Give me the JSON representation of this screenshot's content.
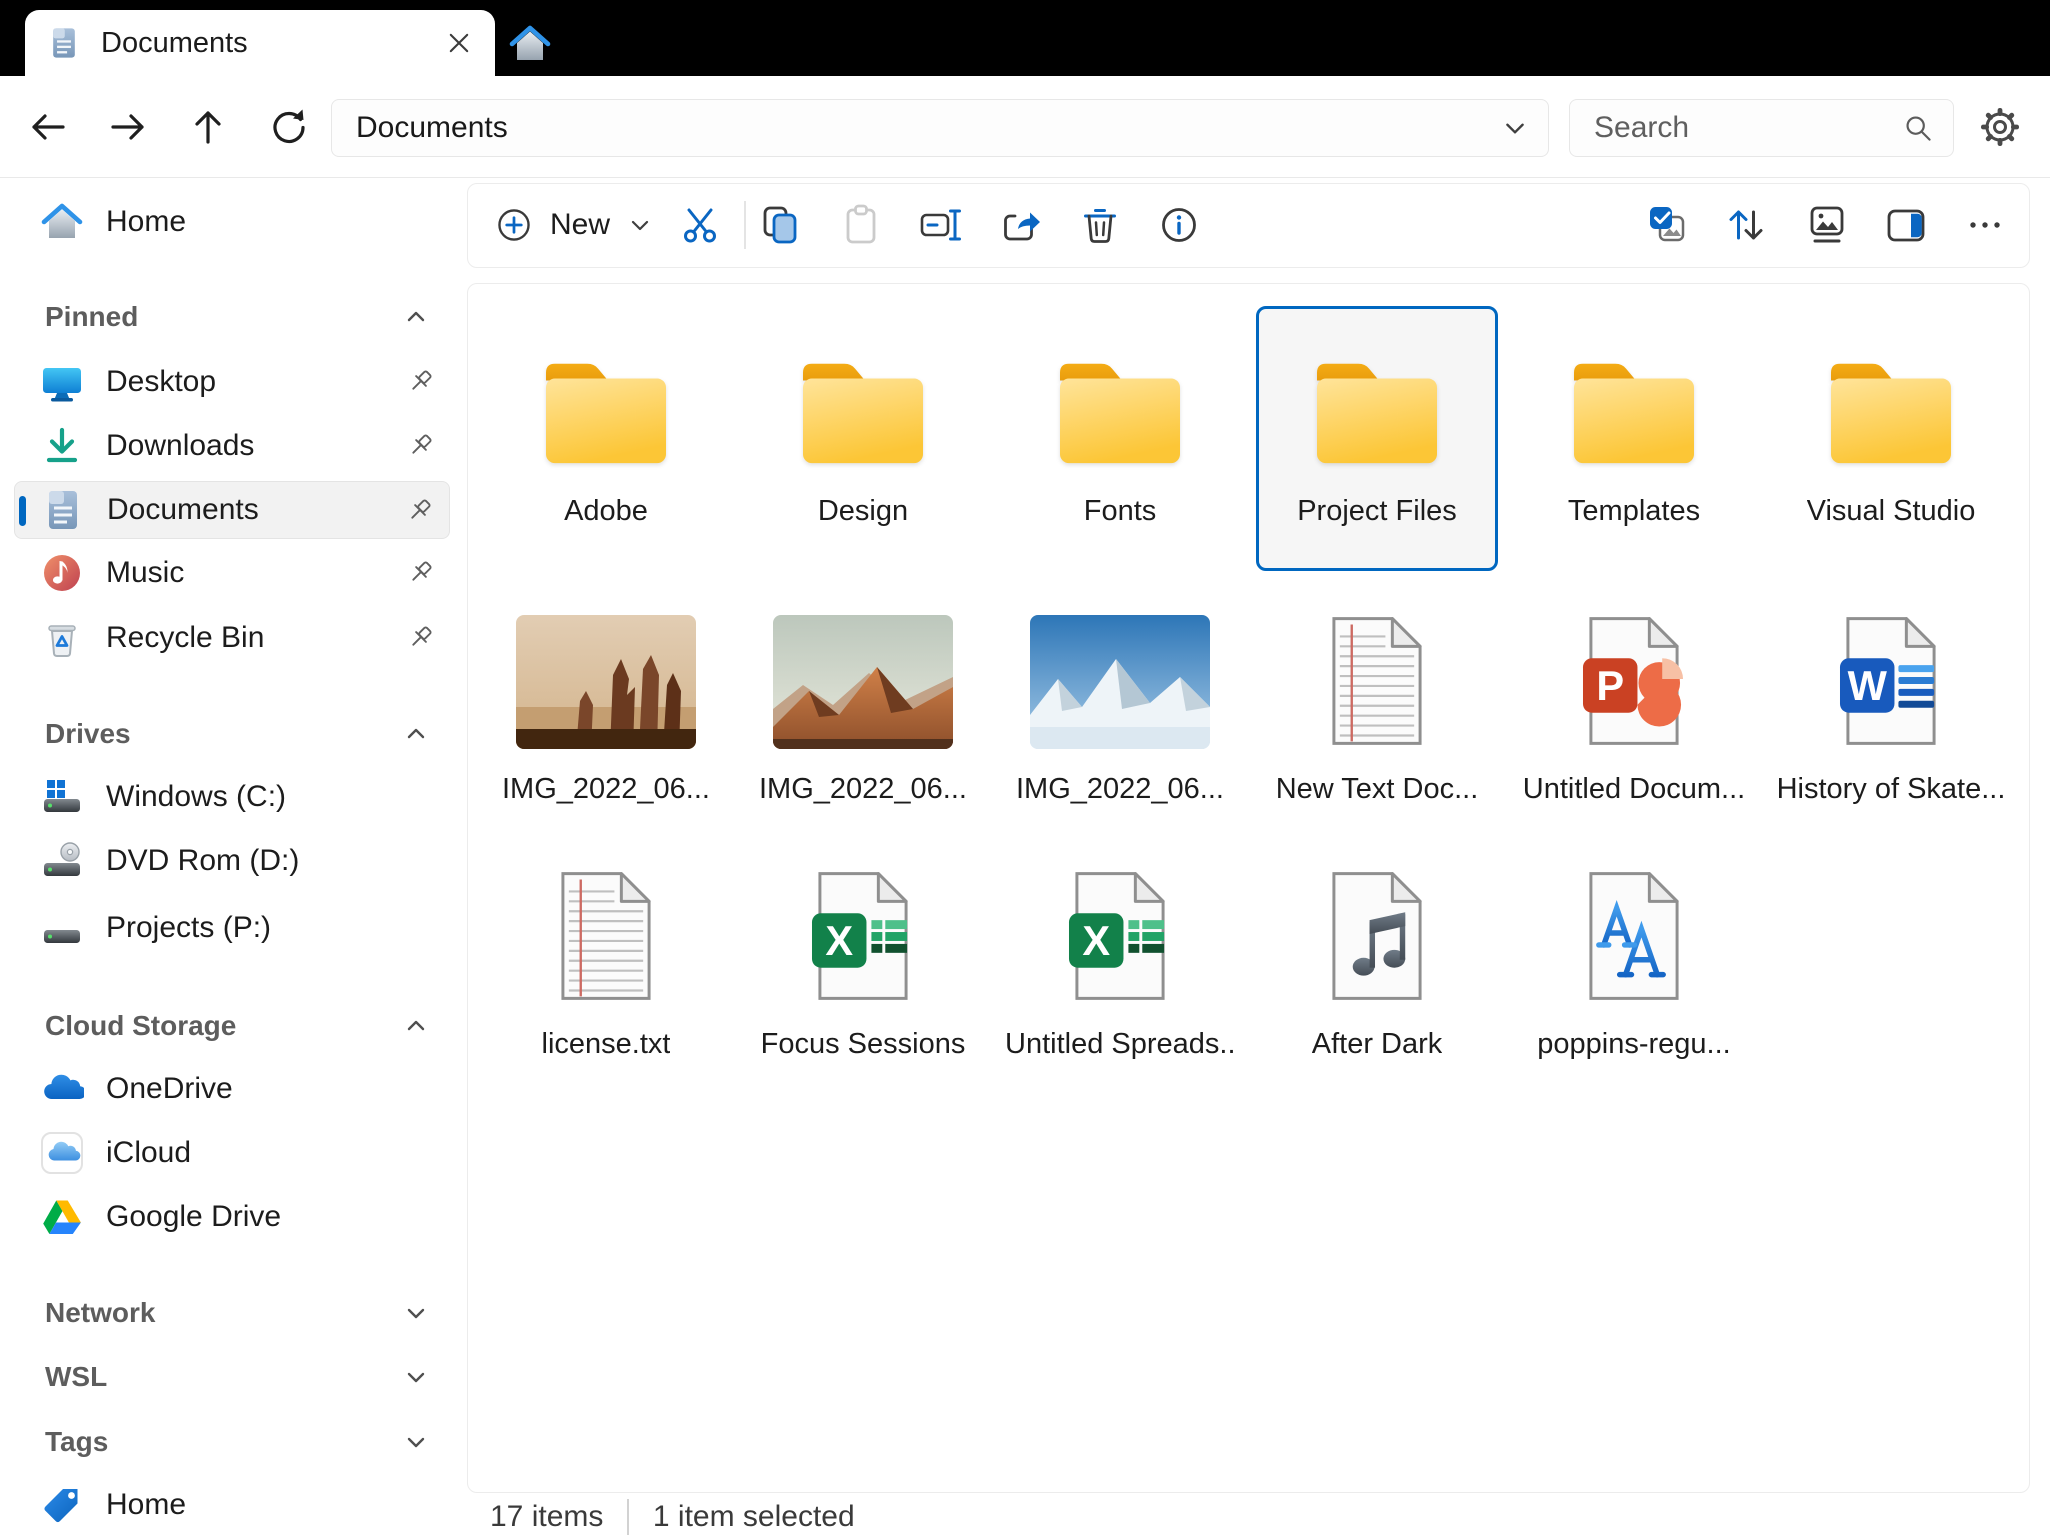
{
  "titlebar": {
    "tab_title": "Documents",
    "tab_icon": "document-icon",
    "home_tab_icon": "home-icon",
    "close_icon": "close-icon"
  },
  "navbar": {
    "nav_icons": [
      "arrow-left",
      "arrow-right",
      "arrow-up",
      "refresh"
    ],
    "address": "Documents",
    "search_placeholder": "Search",
    "settings_icon": "gear-icon"
  },
  "toolbar": {
    "new_label": "New",
    "actions": [
      "cut",
      "copy",
      "paste",
      "rename",
      "share",
      "delete",
      "info"
    ],
    "view_actions": [
      "select-all",
      "sort",
      "view",
      "details-pane",
      "more"
    ]
  },
  "sidebar": {
    "home": {
      "icon": "home",
      "label": "Home"
    },
    "sections": [
      {
        "label": "Pinned",
        "expanded": true,
        "items": [
          {
            "icon": "desktop",
            "label": "Desktop",
            "pinned": true
          },
          {
            "icon": "downloads",
            "label": "Downloads",
            "pinned": true
          },
          {
            "icon": "documents",
            "label": "Documents",
            "pinned": true,
            "selected": true
          },
          {
            "icon": "music",
            "label": "Music",
            "pinned": true
          },
          {
            "icon": "recycle-bin",
            "label": "Recycle Bin",
            "pinned": true
          }
        ]
      },
      {
        "label": "Drives",
        "expanded": true,
        "items": [
          {
            "icon": "drive-windows",
            "label": "Windows (C:)"
          },
          {
            "icon": "drive-dvd",
            "label": "DVD Rom (D:)"
          },
          {
            "icon": "drive",
            "label": "Projects (P:)"
          }
        ]
      },
      {
        "label": "Cloud Storage",
        "expanded": true,
        "items": [
          {
            "icon": "onedrive",
            "label": "OneDrive"
          },
          {
            "icon": "icloud",
            "label": "iCloud"
          },
          {
            "icon": "google-drive",
            "label": "Google Drive"
          }
        ]
      },
      {
        "label": "Network",
        "expanded": false,
        "items": []
      },
      {
        "label": "WSL",
        "expanded": false,
        "items": []
      },
      {
        "label": "Tags",
        "expanded": false,
        "items": [
          {
            "icon": "tag",
            "label": "Home"
          }
        ]
      }
    ]
  },
  "files": [
    {
      "type": "folder",
      "label": "Adobe",
      "selected": false
    },
    {
      "type": "folder",
      "label": "Design",
      "selected": false
    },
    {
      "type": "folder",
      "label": "Fonts",
      "selected": false
    },
    {
      "type": "folder",
      "label": "Project Files",
      "selected": true
    },
    {
      "type": "folder",
      "label": "Templates",
      "selected": false
    },
    {
      "type": "folder",
      "label": "Visual Studio",
      "selected": false
    },
    {
      "type": "image",
      "label": "IMG_2022_06...",
      "selected": false
    },
    {
      "type": "image",
      "label": "IMG_2022_06...",
      "selected": false
    },
    {
      "type": "image",
      "label": "IMG_2022_06...",
      "selected": false
    },
    {
      "type": "text-document",
      "label": "New Text Doc...",
      "selected": false
    },
    {
      "type": "powerpoint",
      "label": "Untitled Docum...",
      "selected": false
    },
    {
      "type": "word",
      "label": "History of Skate...",
      "selected": false
    },
    {
      "type": "text-document",
      "label": "license.txt",
      "selected": false
    },
    {
      "type": "excel",
      "label": "Focus Sessions",
      "selected": false
    },
    {
      "type": "excel",
      "label": "Untitled Spreads...",
      "selected": false
    },
    {
      "type": "audio",
      "label": "After Dark",
      "selected": false
    },
    {
      "type": "font-file",
      "label": "poppins-regu...",
      "selected": false
    }
  ],
  "statusbar": {
    "count": "17 items",
    "selection": "1 item selected"
  }
}
